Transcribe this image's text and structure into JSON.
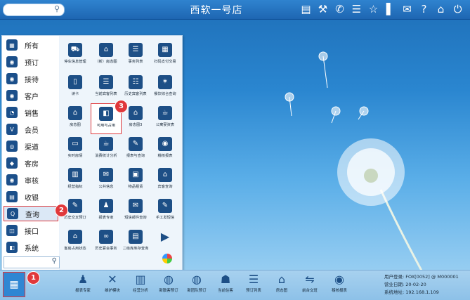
{
  "topbar": {
    "title": "西软一号店",
    "search_icon": "search-icon",
    "icons": [
      "signal-icon",
      "tools-icon",
      "phone-icon",
      "menu-icon",
      "star-icon",
      "barcode-icon",
      "mail-icon",
      "help-icon",
      "home-icon",
      "power-icon"
    ]
  },
  "menu": {
    "categories": [
      {
        "label": "所有",
        "icon": "grid-icon"
      },
      {
        "label": "预订",
        "icon": "person-icon"
      },
      {
        "label": "接待",
        "icon": "reception-icon"
      },
      {
        "label": "客户",
        "icon": "customer-icon"
      },
      {
        "label": "销售",
        "icon": "chart-icon"
      },
      {
        "label": "会员",
        "icon": "vip-icon"
      },
      {
        "label": "渠道",
        "icon": "channel-icon"
      },
      {
        "label": "客房",
        "icon": "room-icon"
      },
      {
        "label": "审核",
        "icon": "eye-icon"
      },
      {
        "label": "收银",
        "icon": "cashier-icon"
      },
      {
        "label": "查询",
        "icon": "search-icon"
      },
      {
        "label": "接口",
        "icon": "interface-icon"
      },
      {
        "label": "系统",
        "icon": "system-icon"
      }
    ],
    "apps": [
      {
        "label": "停车信息管理",
        "icon": "car-icon"
      },
      {
        "label": "（新）房态图",
        "icon": "house-icon"
      },
      {
        "label": "事务列表",
        "icon": "list-icon"
      },
      {
        "label": "扫码支付交易",
        "icon": "qr-icon"
      },
      {
        "label": "读卡",
        "icon": "card-icon"
      },
      {
        "label": "当前宾客列表",
        "icon": "guests-icon"
      },
      {
        "label": "历史宾客列表",
        "icon": "history-icon"
      },
      {
        "label": "餐饮综合查询",
        "icon": "dining-icon"
      },
      {
        "label": "房态图",
        "icon": "house-icon"
      },
      {
        "label": "可用与占用",
        "icon": "availability-icon"
      },
      {
        "label": "房态图3",
        "icon": "house-icon"
      },
      {
        "label": "公寓宴资表",
        "icon": "tea-icon"
      },
      {
        "label": "实时房情",
        "icon": "monitor-icon"
      },
      {
        "label": "消费统计分析",
        "icon": "cup-icon"
      },
      {
        "label": "报表与查询",
        "icon": "report-icon"
      },
      {
        "label": "稽核报表",
        "icon": "eye-icon"
      },
      {
        "label": "经营指标",
        "icon": "bar-icon"
      },
      {
        "label": "公共信息",
        "icon": "chat-icon"
      },
      {
        "label": "物品租赁",
        "icon": "box-icon"
      },
      {
        "label": "宾客查询",
        "icon": "guest-search-icon"
      },
      {
        "label": "历史交叉预订",
        "icon": "cross-icon"
      },
      {
        "label": "报表专家",
        "icon": "expert-icon"
      },
      {
        "label": "短信邮件查询",
        "icon": "mail-icon"
      },
      {
        "label": "手工发短信",
        "icon": "sms-icon"
      },
      {
        "label": "客房占用状态",
        "icon": "room-status-icon"
      },
      {
        "label": "历史宴会事务",
        "icon": "link-icon"
      },
      {
        "label": "二级库库存查询",
        "icon": "stock-icon"
      },
      {
        "label": "",
        "icon": "arrow-right-icon"
      }
    ]
  },
  "badges": [
    "1",
    "2",
    "3"
  ],
  "dock": [
    {
      "label": "报表专家",
      "icon": "expert-icon"
    },
    {
      "label": "维护模块",
      "icon": "tools-icon"
    },
    {
      "label": "经营分析",
      "icon": "bar-icon"
    },
    {
      "label": "新散客预订",
      "icon": "add-user-icon"
    },
    {
      "label": "新团队预订",
      "icon": "team-icon"
    },
    {
      "label": "当前住客",
      "icon": "guest-icon"
    },
    {
      "label": "预订列表",
      "icon": "list-icon"
    },
    {
      "label": "房态图",
      "icon": "house-icon"
    },
    {
      "label": "前台交班",
      "icon": "handover-icon"
    },
    {
      "label": "稽核报表",
      "icon": "eye-icon"
    }
  ],
  "info": {
    "user": "用户登录: FOX[0052] @ M000001",
    "date": "营业日期: 20-02-20",
    "address": "系统地址: 192.168.1.109"
  }
}
